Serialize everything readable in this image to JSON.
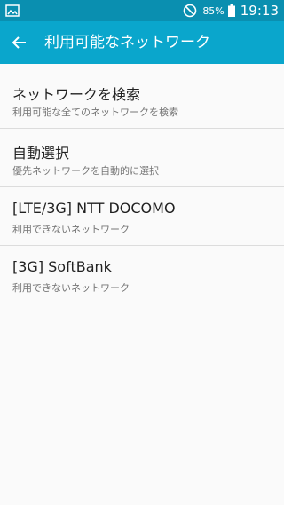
{
  "status_bar": {
    "battery_percent": "85%",
    "time": "19:13"
  },
  "app_bar": {
    "title": "利用可能なネットワーク"
  },
  "networks": [
    {
      "title": "ネットワークを検索",
      "summary": "利用可能な全てのネットワークを検索"
    },
    {
      "title": "自動選択",
      "summary": "優先ネットワークを自動的に選択"
    },
    {
      "title": "[LTE/3G] NTT DOCOMO",
      "summary": "利用できないネットワーク"
    },
    {
      "title": "[3G] SoftBank",
      "summary": "利用できないネットワーク"
    }
  ],
  "colors": {
    "status_bar": "#0a8fb0",
    "app_bar": "#0aa6cc",
    "background": "#fafafa"
  }
}
